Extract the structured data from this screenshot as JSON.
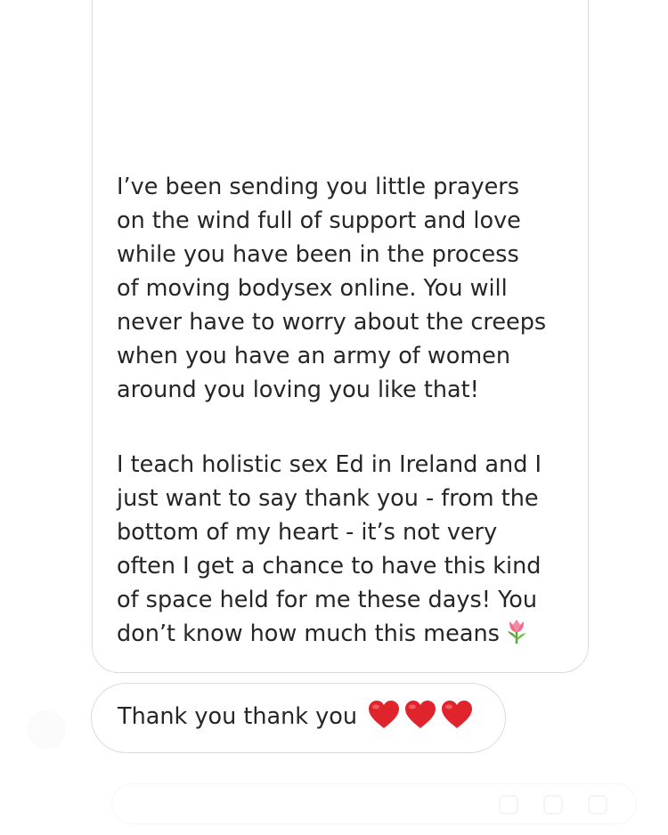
{
  "conversation": {
    "main_message": {
      "faded_lines": [
        "",
        ""
      ],
      "paragraph_1": "I’ve been sending you little prayers\non the wind full of support and love\nwhile you have been in the process\nof moving bodysex online. You will\nnever have to worry about the creeps\nwhen you have an army of women\naround you loving you like that!",
      "paragraph_2": "I teach holistic sex Ed in Ireland and I\njust want to say thank you - from the\nbottom of my heart - it’s not very\noften I get a chance to have this kind\nof space held for me these days! You\ndon’t know how much this means",
      "trailing_emoji": "tulip-emoji"
    },
    "reply_message": {
      "text": "Thank you thank you",
      "emojis": [
        "red-heart-emoji",
        "red-heart-emoji",
        "red-heart-emoji"
      ]
    }
  },
  "colors": {
    "text": "#262626",
    "bubble_border": "#dbdbdb",
    "heart": "#e0242c",
    "tulip_petal": "#f06b8a",
    "tulip_stem": "#5aa83c"
  }
}
